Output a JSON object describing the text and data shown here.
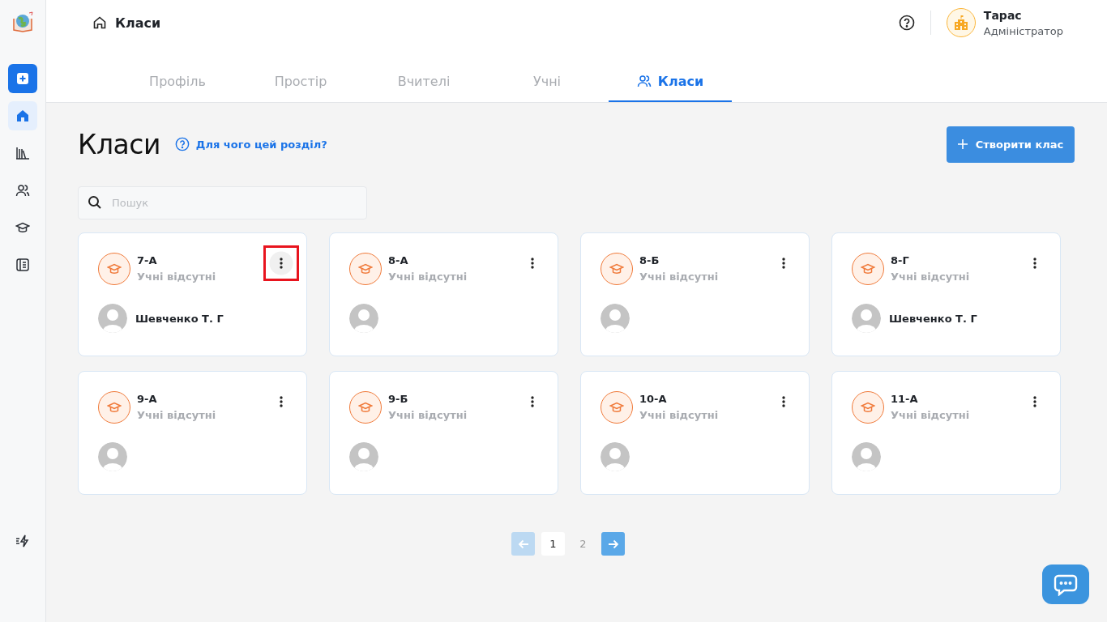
{
  "sidebar": {
    "items": [
      {
        "kind": "add",
        "selected": false
      },
      {
        "kind": "home",
        "selected": true
      },
      {
        "kind": "library",
        "selected": false
      },
      {
        "kind": "people",
        "selected": false
      },
      {
        "kind": "cap",
        "selected": false
      },
      {
        "kind": "journal",
        "selected": false
      }
    ],
    "bottom_items": [
      {
        "kind": "bolt",
        "selected": false
      }
    ]
  },
  "header": {
    "breadcrumb": "Класи",
    "user": {
      "name": "Тарас",
      "role": "Адміністратор"
    }
  },
  "tabs": [
    {
      "label": "Профіль",
      "selected": false
    },
    {
      "label": "Простір",
      "selected": false
    },
    {
      "label": "Вчителі",
      "selected": false
    },
    {
      "label": "Учні",
      "selected": false
    },
    {
      "label": "Класи",
      "selected": true
    }
  ],
  "page": {
    "title": "Класи",
    "help_link": "Для чого цей розділ?",
    "create_button": "Створити клас"
  },
  "search": {
    "placeholder": "Пошук"
  },
  "cards": [
    {
      "name": "7-А",
      "status": "Учні відсутні",
      "teacher": "Шевченко Т. Г",
      "menu_highlighted": true
    },
    {
      "name": "8-А",
      "status": "Учні відсутні",
      "menu_highlighted": false
    },
    {
      "name": "8-Б",
      "status": "Учні відсутні",
      "menu_highlighted": false
    },
    {
      "name": "8-Г",
      "status": "Учні відсутні",
      "teacher": "Шевченко Т. Г",
      "menu_highlighted": false
    },
    {
      "name": "9-А",
      "status": "Учні відсутні",
      "menu_highlighted": false
    },
    {
      "name": "9-Б",
      "status": "Учні відсутні",
      "menu_highlighted": false
    },
    {
      "name": "10-А",
      "status": "Учні відсутні",
      "menu_highlighted": false
    },
    {
      "name": "11-А",
      "status": "Учні відсутні",
      "menu_highlighted": false
    }
  ],
  "pagination": {
    "prev_disabled": true,
    "next_disabled": false,
    "pages": [
      {
        "label": "1",
        "selected": true
      },
      {
        "label": "2",
        "selected": false
      }
    ]
  }
}
